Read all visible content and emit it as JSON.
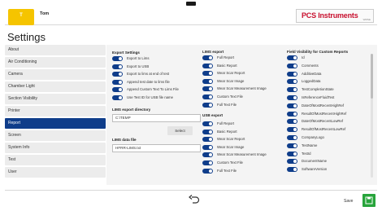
{
  "header": {
    "user_name": "Tom",
    "avatar_letter": "T",
    "logo_text": "PCS Instruments",
    "logo_sub": "WMSE"
  },
  "page_title": "Settings",
  "sidebar": {
    "items": [
      {
        "label": "About"
      },
      {
        "label": "Air Conditioning"
      },
      {
        "label": "Camera"
      },
      {
        "label": "Chamber Light"
      },
      {
        "label": "Section Visibility"
      },
      {
        "label": "Printer"
      },
      {
        "label": "Report",
        "active": true
      },
      {
        "label": "Screen"
      },
      {
        "label": "System Info"
      },
      {
        "label": "Test"
      },
      {
        "label": "User"
      }
    ]
  },
  "export_settings": {
    "title": "Export Settings",
    "items": [
      {
        "label": "Export to Lims",
        "on": true
      },
      {
        "label": "Export to USB",
        "on": true
      },
      {
        "label": "Export to lims at end of test",
        "on": true
      },
      {
        "label": "Append test date to lims file",
        "on": true
      },
      {
        "label": "Append Custom Text To Lims File",
        "on": true
      },
      {
        "label": "Use Test ID for USB file name",
        "on": true
      }
    ],
    "directory_label": "LIMS export directory",
    "directory_value": "C:\\TEMP",
    "select_label": "Select",
    "datafile_label": "LIMS data file",
    "datafile_value": "HFRR-LIMS.txt"
  },
  "lims_export": {
    "title": "LIMS export",
    "items": [
      {
        "label": "Full Report",
        "on": true
      },
      {
        "label": "Basic Report",
        "on": true
      },
      {
        "label": "Wear Scar Report",
        "on": true
      },
      {
        "label": "Wear Scar Image",
        "on": true
      },
      {
        "label": "Wear Scar Measurement Image",
        "on": true
      },
      {
        "label": "Custom Text File",
        "on": true
      },
      {
        "label": "Full Text File",
        "on": true
      }
    ]
  },
  "usb_export": {
    "title": "USB export",
    "items": [
      {
        "label": "Full Report",
        "on": true
      },
      {
        "label": "Basic Report",
        "on": true
      },
      {
        "label": "Wear Scar Report",
        "on": true
      },
      {
        "label": "Wear Scar Image",
        "on": true
      },
      {
        "label": "Wear Scar Measurement Image",
        "on": true
      },
      {
        "label": "Custom Text File",
        "on": true
      },
      {
        "label": "Full Text File",
        "on": true
      }
    ]
  },
  "field_visibility": {
    "title": "Field Visibility for Custom Reports",
    "items": [
      {
        "label": "Id",
        "on": true
      },
      {
        "label": "Comments",
        "on": true
      },
      {
        "label": "AdditiveData",
        "on": true
      },
      {
        "label": "LoggedData",
        "on": true
      },
      {
        "label": "TestCompletionState",
        "on": true
      },
      {
        "label": "IsReferenceFluidTest",
        "on": true
      },
      {
        "label": "DateOfMostRecentHighRef",
        "on": true
      },
      {
        "label": "ResultOfMostRecentHighRef",
        "on": true
      },
      {
        "label": "DateOfMostRecentLowRef",
        "on": true
      },
      {
        "label": "ResultOfMostRecentLowRef",
        "on": true
      },
      {
        "label": "CompanyLogo",
        "on": true
      },
      {
        "label": "TestName",
        "on": true
      },
      {
        "label": "TestId",
        "on": true
      },
      {
        "label": "DocumentName",
        "on": true
      },
      {
        "label": "SoftwareVersion",
        "on": true
      }
    ]
  },
  "footer": {
    "save_label": "Save"
  },
  "colors": {
    "accent": "#0f3d8a",
    "save": "#27a43b",
    "avatar": "#f5c400",
    "logo": "#c8102e"
  }
}
